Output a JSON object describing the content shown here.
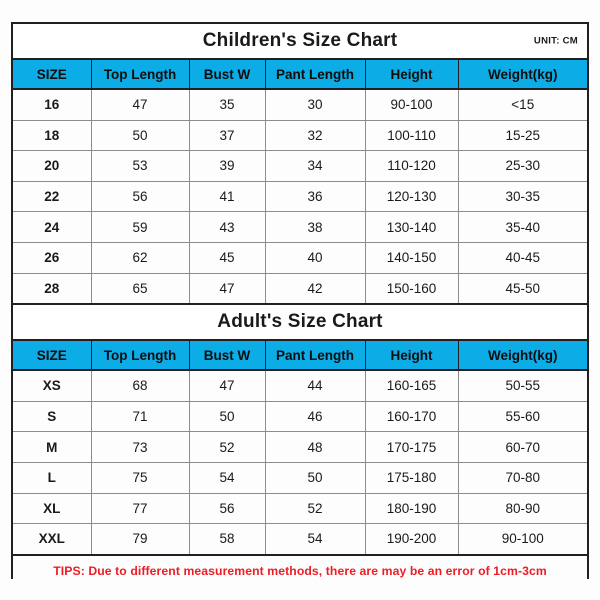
{
  "document": {
    "background_color": "#fdfdfd",
    "border_color": "#231f20",
    "header_fill": "#0cace6",
    "tips_color": "#ed1c24"
  },
  "children_chart": {
    "title": "Children's Size Chart",
    "unit_label": "UNIT: CM",
    "columns": [
      "SIZE",
      "Top Length",
      "Bust W",
      "Pant Length",
      "Height",
      "Weight(kg)"
    ],
    "rows": [
      {
        "size": "16",
        "top_length": "47",
        "bust_w": "35",
        "pant_length": "30",
        "height": "90-100",
        "weight": "<15"
      },
      {
        "size": "18",
        "top_length": "50",
        "bust_w": "37",
        "pant_length": "32",
        "height": "100-110",
        "weight": "15-25"
      },
      {
        "size": "20",
        "top_length": "53",
        "bust_w": "39",
        "pant_length": "34",
        "height": "110-120",
        "weight": "25-30"
      },
      {
        "size": "22",
        "top_length": "56",
        "bust_w": "41",
        "pant_length": "36",
        "height": "120-130",
        "weight": "30-35"
      },
      {
        "size": "24",
        "top_length": "59",
        "bust_w": "43",
        "pant_length": "38",
        "height": "130-140",
        "weight": "35-40"
      },
      {
        "size": "26",
        "top_length": "62",
        "bust_w": "45",
        "pant_length": "40",
        "height": "140-150",
        "weight": "40-45"
      },
      {
        "size": "28",
        "top_length": "65",
        "bust_w": "47",
        "pant_length": "42",
        "height": "150-160",
        "weight": "45-50"
      }
    ]
  },
  "adult_chart": {
    "title": "Adult's Size Chart",
    "columns": [
      "SIZE",
      "Top Length",
      "Bust W",
      "Pant Length",
      "Height",
      "Weight(kg)"
    ],
    "rows": [
      {
        "size": "XS",
        "top_length": "68",
        "bust_w": "47",
        "pant_length": "44",
        "height": "160-165",
        "weight": "50-55"
      },
      {
        "size": "S",
        "top_length": "71",
        "bust_w": "50",
        "pant_length": "46",
        "height": "160-170",
        "weight": "55-60"
      },
      {
        "size": "M",
        "top_length": "73",
        "bust_w": "52",
        "pant_length": "48",
        "height": "170-175",
        "weight": "60-70"
      },
      {
        "size": "L",
        "top_length": "75",
        "bust_w": "54",
        "pant_length": "50",
        "height": "175-180",
        "weight": "70-80"
      },
      {
        "size": "XL",
        "top_length": "77",
        "bust_w": "56",
        "pant_length": "52",
        "height": "180-190",
        "weight": "80-90"
      },
      {
        "size": "XXL",
        "top_length": "79",
        "bust_w": "58",
        "pant_length": "54",
        "height": "190-200",
        "weight": "90-100"
      }
    ]
  },
  "tips": {
    "text": "TIPS: Due to different measurement methods, there are may be an error of 1cm-3cm"
  }
}
